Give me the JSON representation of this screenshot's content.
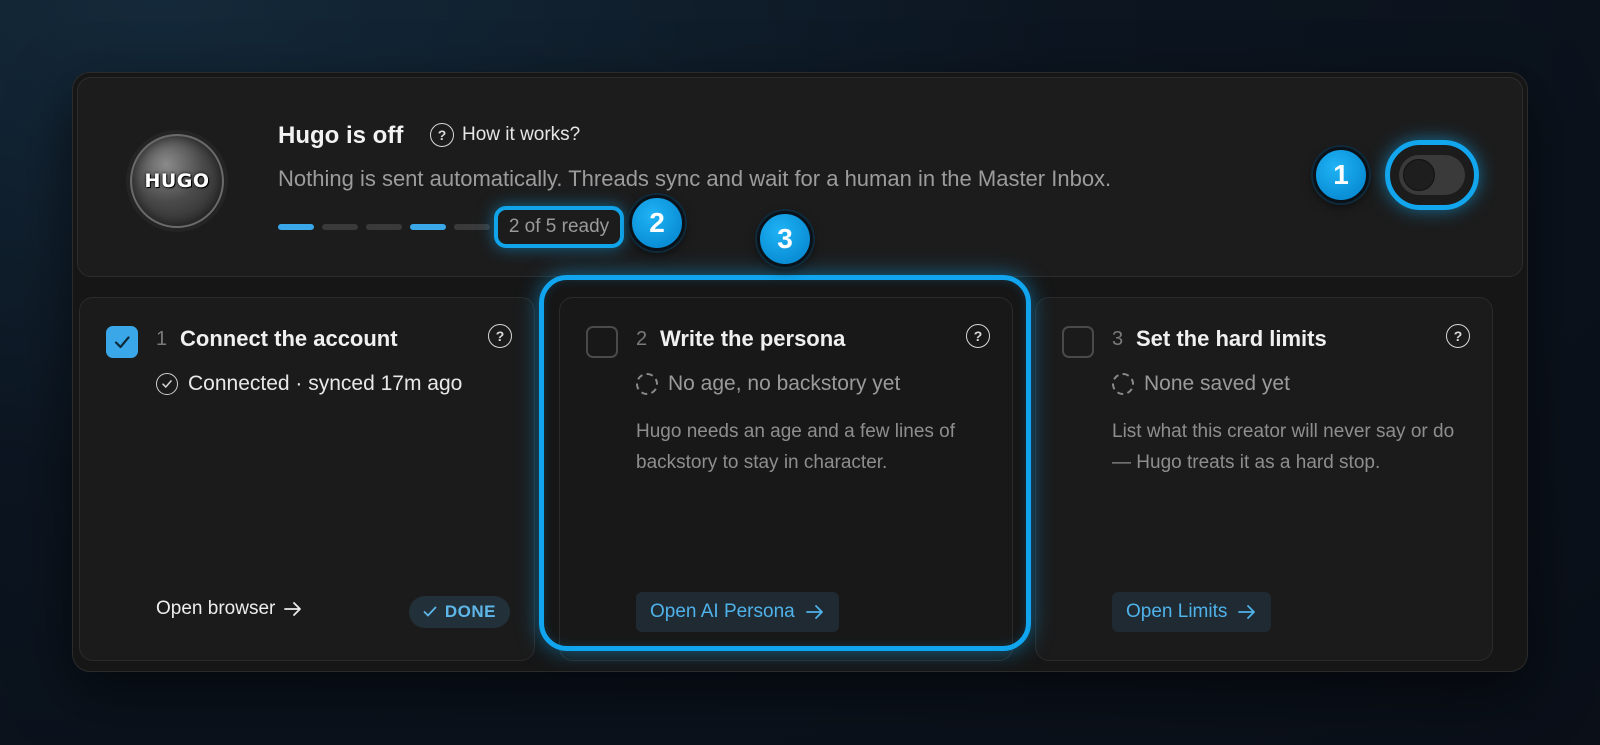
{
  "header": {
    "logo_text": "HUGO",
    "title": "Hugo is off",
    "how_label": "How it works?",
    "subtitle": "Nothing is sent automatically. Threads sync and wait for a human in the Master Inbox.",
    "progress": {
      "ready": 2,
      "total": 5,
      "segments_on": [
        true,
        false,
        false,
        true,
        false
      ],
      "label": "2 of 5 ready"
    },
    "toggle_on": false
  },
  "badges": [
    "1",
    "2",
    "3"
  ],
  "steps": [
    {
      "number": "1",
      "title": "Connect the account",
      "checked": true,
      "status": "Connected · synced 17m ago",
      "description": "",
      "action_label": "Open browser",
      "done_label": "DONE"
    },
    {
      "number": "2",
      "title": "Write the persona",
      "checked": false,
      "status": "No age, no backstory yet",
      "description": "Hugo needs an age and a few lines of backstory to stay in character.",
      "action_label": "Open AI Persona"
    },
    {
      "number": "3",
      "title": "Set the hard limits",
      "checked": false,
      "status": "None saved yet",
      "description": "List what this creator will never say or do — Hugo treats it as a hard stop.",
      "action_label": "Open Limits"
    }
  ],
  "colors": {
    "accent": "#3aa8e8",
    "highlight": "#11a4ea",
    "panel": "#161616"
  },
  "icons": [
    "help-circle-icon",
    "check-icon",
    "check-circle-icon",
    "dashed-circle-icon",
    "arrow-right-icon"
  ]
}
